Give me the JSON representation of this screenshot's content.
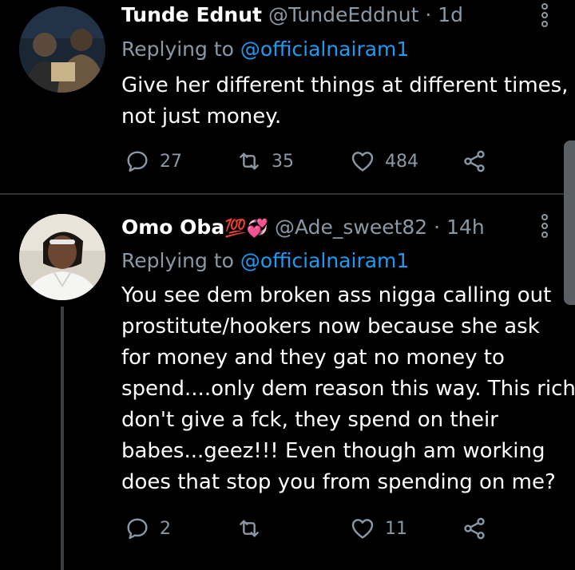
{
  "tweets": [
    {
      "name": "Tunde Ednut",
      "handle": "@TundeEddnut",
      "time": "1d",
      "replying_prefix": "Replying to",
      "replying_mention": "@officialnairam1",
      "lines": [
        "Give her different things at different times,",
        "not just money."
      ],
      "replies": "27",
      "retweets": "35",
      "likes": "484"
    },
    {
      "name": "Omo Oba",
      "name_emoji": "💯💞",
      "handle": "@Ade_sweet82",
      "time": "14h",
      "replying_prefix": "Replying to",
      "replying_mention": "@officialnairam1",
      "lines": [
        "You see dem broken ass nigga calling out",
        "prostitute/hookers now because she ask",
        "for money and they gat no money to",
        "spend....only dem reason this way. This rich",
        "don't give a fck, they spend on their",
        "babes...geez!!! Even though am working",
        "does that stop you from spending on me?"
      ],
      "replies": "2",
      "retweets": "",
      "likes": "11"
    }
  ],
  "separator": "·",
  "colors": {
    "background": "#000000",
    "text": "#ffffff",
    "muted": "#8b98a5",
    "link": "#1d9bf0"
  },
  "icons": [
    "reply-icon",
    "retweet-icon",
    "like-icon",
    "share-icon",
    "more-icon"
  ]
}
